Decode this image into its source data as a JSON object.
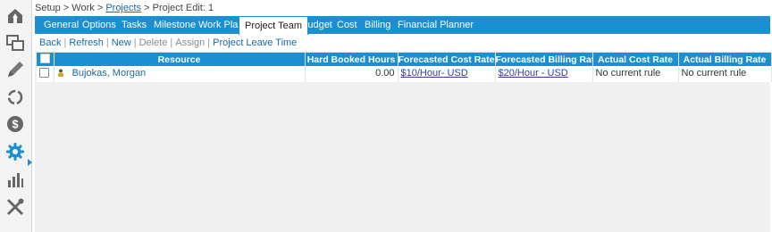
{
  "sidebar": {
    "icons": [
      {
        "name": "home-icon"
      },
      {
        "name": "windows-icon"
      },
      {
        "name": "pencil-icon"
      },
      {
        "name": "refresh-cycle-icon"
      },
      {
        "name": "dollar-icon"
      },
      {
        "name": "gear-icon"
      },
      {
        "name": "bar-chart-icon"
      },
      {
        "name": "tools-icon"
      }
    ],
    "active": "gear-icon",
    "accent_color": "#1a8fd1"
  },
  "breadcrumb": {
    "setup": "Setup",
    "sep1": " > ",
    "work": "Work",
    "sep2": " > ",
    "projects": "Projects",
    "sep3": " > ",
    "current": "Project Edit: 1"
  },
  "tabs": [
    {
      "label": "General"
    },
    {
      "label": "Options"
    },
    {
      "label": "Tasks"
    },
    {
      "label": "Milestone"
    },
    {
      "label": "Work Plan"
    },
    {
      "label": "Project Team",
      "active": true
    },
    {
      "label": "Budget"
    },
    {
      "label": "Cost"
    },
    {
      "label": "Billing"
    },
    {
      "label": "Financial Planner"
    }
  ],
  "actions": {
    "back": "Back",
    "refresh": "Refresh",
    "new": "New",
    "delete": "Delete",
    "assign": "Assign",
    "leave": "Project Leave Time",
    "separator": "|"
  },
  "table": {
    "headers": {
      "resource": "Resource",
      "hard_booked": "Hard Booked Hours",
      "forecast_cost": "Forecasted Cost Rate",
      "forecast_billing": "Forecasted Billing Rate",
      "actual_cost": "Actual Cost Rate",
      "actual_billing": "Actual Billing Rate"
    },
    "rows": [
      {
        "resource": "Bujokas, Morgan",
        "hard_booked": "0.00",
        "forecast_cost": "$10/Hour- USD",
        "forecast_billing": "$20/Hour - USD",
        "actual_cost": "No current rule",
        "actual_billing": "No current rule"
      }
    ]
  },
  "colors": {
    "header_bg": "#1a8fd1",
    "link": "#1a6aa8",
    "content_bg": "#f0f0f0"
  }
}
